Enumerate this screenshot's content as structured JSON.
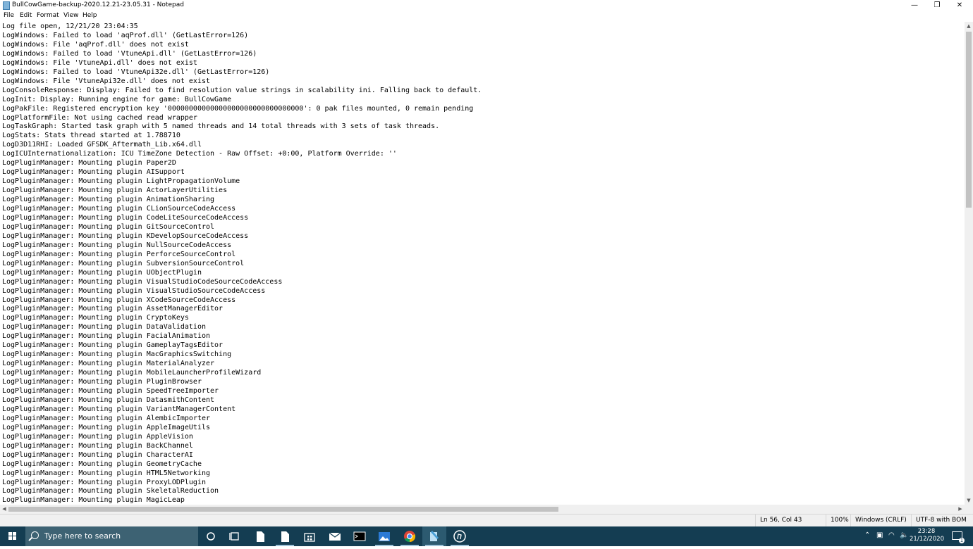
{
  "window": {
    "title": "BullCowGame-backup-2020.12.21-23.05.31 - Notepad",
    "controls": {
      "minimize": "—",
      "restore": "❐",
      "close": "✕"
    }
  },
  "menu": [
    "File",
    "Edit",
    "Format",
    "View",
    "Help"
  ],
  "lines": [
    "Log file open, 12/21/20 23:04:35",
    "LogWindows: Failed to load 'aqProf.dll' (GetLastError=126)",
    "LogWindows: File 'aqProf.dll' does not exist",
    "LogWindows: Failed to load 'VtuneApi.dll' (GetLastError=126)",
    "LogWindows: File 'VtuneApi.dll' does not exist",
    "LogWindows: Failed to load 'VtuneApi32e.dll' (GetLastError=126)",
    "LogWindows: File 'VtuneApi32e.dll' does not exist",
    "LogConsoleResponse: Display: Failed to find resolution value strings in scalability ini. Falling back to default.",
    "LogInit: Display: Running engine for game: BullCowGame",
    "LogPakFile: Registered encryption key '00000000000000000000000000000000': 0 pak files mounted, 0 remain pending",
    "LogPlatformFile: Not using cached read wrapper",
    "LogTaskGraph: Started task graph with 5 named threads and 14 total threads with 3 sets of task threads.",
    "LogStats: Stats thread started at 1.788710",
    "LogD3D11RHI: Loaded GFSDK_Aftermath_Lib.x64.dll",
    "LogICUInternationalization: ICU TimeZone Detection - Raw Offset: +0:00, Platform Override: ''",
    "LogPluginManager: Mounting plugin Paper2D",
    "LogPluginManager: Mounting plugin AISupport",
    "LogPluginManager: Mounting plugin LightPropagationVolume",
    "LogPluginManager: Mounting plugin ActorLayerUtilities",
    "LogPluginManager: Mounting plugin AnimationSharing",
    "LogPluginManager: Mounting plugin CLionSourceCodeAccess",
    "LogPluginManager: Mounting plugin CodeLiteSourceCodeAccess",
    "LogPluginManager: Mounting plugin GitSourceControl",
    "LogPluginManager: Mounting plugin KDevelopSourceCodeAccess",
    "LogPluginManager: Mounting plugin NullSourceCodeAccess",
    "LogPluginManager: Mounting plugin PerforceSourceControl",
    "LogPluginManager: Mounting plugin SubversionSourceControl",
    "LogPluginManager: Mounting plugin UObjectPlugin",
    "LogPluginManager: Mounting plugin VisualStudioCodeSourceCodeAccess",
    "LogPluginManager: Mounting plugin VisualStudioSourceCodeAccess",
    "LogPluginManager: Mounting plugin XCodeSourceCodeAccess",
    "LogPluginManager: Mounting plugin AssetManagerEditor",
    "LogPluginManager: Mounting plugin CryptoKeys",
    "LogPluginManager: Mounting plugin DataValidation",
    "LogPluginManager: Mounting plugin FacialAnimation",
    "LogPluginManager: Mounting plugin GameplayTagsEditor",
    "LogPluginManager: Mounting plugin MacGraphicsSwitching",
    "LogPluginManager: Mounting plugin MaterialAnalyzer",
    "LogPluginManager: Mounting plugin MobileLauncherProfileWizard",
    "LogPluginManager: Mounting plugin PluginBrowser",
    "LogPluginManager: Mounting plugin SpeedTreeImporter",
    "LogPluginManager: Mounting plugin DatasmithContent",
    "LogPluginManager: Mounting plugin VariantManagerContent",
    "LogPluginManager: Mounting plugin AlembicImporter",
    "LogPluginManager: Mounting plugin AppleImageUtils",
    "LogPluginManager: Mounting plugin AppleVision",
    "LogPluginManager: Mounting plugin BackChannel",
    "LogPluginManager: Mounting plugin CharacterAI",
    "LogPluginManager: Mounting plugin GeometryCache",
    "LogPluginManager: Mounting plugin HTML5Networking",
    "LogPluginManager: Mounting plugin ProxyLODPlugin",
    "LogPluginManager: Mounting plugin SkeletalReduction",
    "LogPluginManager: Mounting plugin MagicLeap"
  ],
  "status": {
    "position": "Ln 56, Col 43",
    "zoom": "100%",
    "line_ending": "Windows (CRLF)",
    "encoding": "UTF-8 with BOM"
  },
  "taskbar": {
    "search_placeholder": "Type here to search",
    "apps": [
      "task-view",
      "file-icon",
      "notepad",
      "store",
      "mail",
      "terminal",
      "photos",
      "chrome",
      "notepad-active",
      "unreal"
    ],
    "time": "23:28",
    "date": "21/12/2020",
    "notification_count": "1"
  },
  "colors": {
    "taskbar": "#143d52",
    "search": "#3d6273",
    "accent": "#9ec3d9"
  }
}
